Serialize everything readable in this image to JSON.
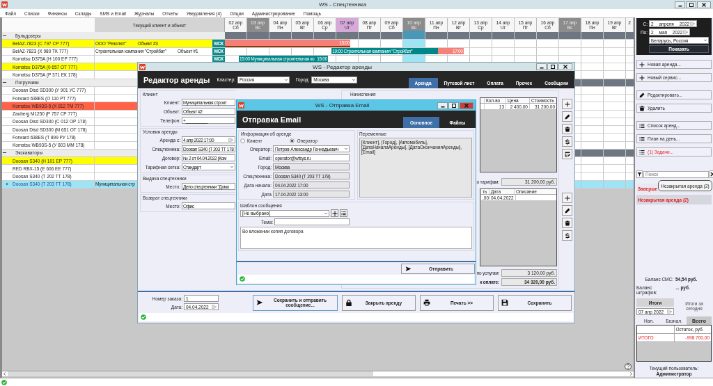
{
  "window": {
    "title": "WS - Спецтехника"
  },
  "menu": [
    "Файл",
    "Списки",
    "Финансы",
    "Склады",
    "SMS и Email",
    "Журналы",
    "Отчеты",
    "Уведомления (4)",
    "Опции",
    "Администрирование",
    "Помощь"
  ],
  "schedule": {
    "client_header": "Текущий клиент и объект",
    "days": [
      {
        "date": "02 апр",
        "weekday": "Сб",
        "kind": "normal",
        "selected": false
      },
      {
        "date": "03 апр",
        "weekday": "Вс",
        "kind": "weekend",
        "selected": false
      },
      {
        "date": "04 апр",
        "weekday": "Пн",
        "kind": "normal",
        "selected": false
      },
      {
        "date": "05 апр",
        "weekday": "Вт",
        "kind": "normal",
        "selected": false
      },
      {
        "date": "06 апр",
        "weekday": "Ср",
        "kind": "normal",
        "selected": false
      },
      {
        "date": "07 апр",
        "weekday": "Чт",
        "kind": "today",
        "selected": false
      },
      {
        "date": "08 апр",
        "weekday": "Пт",
        "kind": "normal",
        "selected": false
      },
      {
        "date": "09 апр",
        "weekday": "Сб",
        "kind": "normal",
        "selected": false
      },
      {
        "date": "10 апр",
        "weekday": "Вс",
        "kind": "weekend",
        "selected": true
      },
      {
        "date": "11 апр",
        "weekday": "Пн",
        "kind": "normal",
        "selected": false
      },
      {
        "date": "12 апр",
        "weekday": "Вт",
        "kind": "normal",
        "selected": false
      },
      {
        "date": "13 апр",
        "weekday": "Ср",
        "kind": "normal",
        "selected": false
      },
      {
        "date": "14 апр",
        "weekday": "Чт",
        "kind": "normal",
        "selected": false
      },
      {
        "date": "15 апр",
        "weekday": "Пт",
        "kind": "normal",
        "selected": false
      },
      {
        "date": "16 апр",
        "weekday": "Сб",
        "kind": "normal",
        "selected": false
      },
      {
        "date": "17 апр",
        "weekday": "Вс",
        "kind": "weekend",
        "selected": false
      },
      {
        "date": "18 апр",
        "weekday": "Пн",
        "kind": "normal",
        "selected": false
      },
      {
        "date": "19 апр",
        "weekday": "Вт",
        "kind": "normal",
        "selected": false
      },
      {
        "date": "2",
        "kind": "normal",
        "selected": false
      }
    ],
    "groups": [
      {
        "name": "Бульдозеры",
        "expanded": true,
        "rows": [
          {
            "vehicle": "BelAZ-7823 (С 797 СР 777)",
            "color": "#ffff00",
            "selected": false,
            "client": "ООО \"Резолют\"",
            "object": "Объект #3",
            "region": "МСК",
            "bars": [
              {
                "kind": "bar",
                "color": "#f58078",
                "end_label": "15:00"
              },
              {
                "kind": "line",
                "color": "#8b3a0c"
              }
            ]
          },
          {
            "vehicle": "BelAZ-7823 (Х 980 ТК 777)",
            "color": "#ffffff",
            "selected": false,
            "client": "Строительная компания \"Стройбат\"",
            "object": "Объект #1",
            "region": "МСК",
            "bars": [
              {
                "kind": "bar",
                "color": "#00878a",
                "label": "19:00 Строительная компания \"Стройбат\""
              },
              {
                "kind": "bar",
                "color": "#f58078",
                "end_label": "17:00"
              }
            ]
          },
          {
            "vehicle": "Komatsu D375A (Н 100 ЕР 777)",
            "color": "#ffffff",
            "selected": false,
            "region": "МСК",
            "bars": [
              {
                "kind": "bar",
                "color": "#00878a",
                "label": "15:00 Муниципальная строительная ко",
                "end_label": "15:00"
              }
            ]
          },
          {
            "vehicle": "Komatsu D375A (0 657 ОТ 777)",
            "color": "#ffff00",
            "selected": false
          },
          {
            "vehicle": "Komatsu D375A (Р 371 ЕК 178)",
            "color": "#ffffff",
            "selected": false
          }
        ]
      },
      {
        "name": "Погрузчики",
        "expanded": true,
        "rows": [
          {
            "vehicle": "Doosan Disd SD300 (У 901 УС 777)",
            "color": "#ffffff",
            "selected": false
          },
          {
            "vehicle": "Forward 638ES (О 110 РТ 777)",
            "color": "#ffffff",
            "selected": false
          },
          {
            "vehicle": "Komatsu WB93S-5 (Х 812 ТМ 777)",
            "color": "#ff6347",
            "selected": false
          },
          {
            "vehicle": "Zauberg M1250 (Р 757 СР 777)",
            "color": "#ffffff",
            "selected": false
          },
          {
            "vehicle": "Doosan Disd SD300 (С 012 ОР 178)",
            "color": "#ffffff",
            "selected": false
          },
          {
            "vehicle": "Doosan Disd SD300 (М 651 ОТ 178)",
            "color": "#ffffff",
            "selected": false
          },
          {
            "vehicle": "Forward 638ES (Т 899 РУ 178)",
            "color": "#ffffff",
            "selected": false
          },
          {
            "vehicle": "Komatsu WB93S-5 (У 803 ММ 178)",
            "color": "#ffffff",
            "selected": false
          }
        ]
      },
      {
        "name": "Экскаваторы",
        "expanded": true,
        "rows": [
          {
            "vehicle": "Doosan S340 (Н 101 ЕР 777)",
            "color": "#ffff00",
            "selected": false
          },
          {
            "vehicle": "RED RBX-15 (Е 606 ЕЕ 777)",
            "color": "#ffffff",
            "selected": false
          },
          {
            "vehicle": "Doosan S340 (Т 202 ТТ 178)",
            "color": "#ffffff",
            "selected": false
          },
          {
            "vehicle": "Doosan S340 (Т 203 ТТ 178)",
            "color": "#9de4f7",
            "selected": true,
            "client": "Муниципальная стр"
          }
        ]
      }
    ]
  },
  "filter_panel": {
    "from_label": "С:",
    "from": "2 апреля 2022",
    "to_label": "По:",
    "to": "2 мая 2022",
    "region": "Беларусь, Россия",
    "show_button": "Показать"
  },
  "action_groups": [
    {
      "buttons": [
        {
          "label": "Новая аренда...",
          "kind": "plus",
          "alert": false
        },
        {
          "label": "Новый сервис...",
          "kind": "plus",
          "alert": false
        }
      ]
    },
    {
      "buttons": [
        {
          "label": "Редактировать...",
          "kind": "pencil",
          "alert": false
        },
        {
          "label": "Удалить",
          "kind": "trash",
          "alert": false
        }
      ]
    },
    {
      "buttons": [
        {
          "label": "Список аренд...",
          "kind": "list",
          "alert": false
        },
        {
          "label": "План на день...",
          "kind": "list",
          "alert": false
        },
        {
          "label": "(1) Задачи...",
          "kind": "list",
          "alert": true
        }
      ]
    }
  ],
  "search": {
    "placeholder": "Поиск"
  },
  "status_filters": [
    {
      "label": "Заверше",
      "selected": false
    },
    {
      "label": "Незакрытая аренда (2)",
      "selected": true
    }
  ],
  "tooltip": "Незакрытая аренда (2)",
  "balances": [
    {
      "label": "Баланс СМС:",
      "value": "54,54 руб."
    },
    {
      "label": "Баланс штрафов:",
      "value": "... руб."
    }
  ],
  "totals": {
    "button": "Итоги",
    "date": "07 апр 2022",
    "caption": "Итоги за сегодня",
    "tabs": [
      {
        "label": "Нал.",
        "selected": false
      },
      {
        "label": "Безнал.",
        "selected": false
      },
      {
        "label": "Всего",
        "selected": true
      }
    ],
    "column": "Остаток, руб.",
    "rows": [
      {
        "label": "ИТОГО",
        "value": "-998 700,00"
      }
    ]
  },
  "current_user": {
    "label": "Текущий пользователь:",
    "name": "Администратор"
  },
  "rental_editor": {
    "title": "WS - Редактор аренды",
    "heading": "Редактор аренды",
    "cluster_label": "Кластер:",
    "cluster": "Россия",
    "city_label": "Город:",
    "city": "Москва",
    "tabs": [
      {
        "label": "Аренда",
        "selected": true
      },
      {
        "label": "Путевой лист",
        "selected": false
      },
      {
        "label": "Оплата",
        "selected": false
      },
      {
        "label": "Прочее",
        "selected": false
      },
      {
        "label": "Сообщени",
        "selected": false
      }
    ],
    "groups": [
      {
        "title": "Клиент",
        "fields": [
          {
            "label": "Клиент:",
            "value": "Муниципальная строит",
            "kind": "text"
          },
          {
            "label": "Объект:",
            "value": "Объект #2",
            "kind": "text"
          },
          {
            "label": "Телефон:",
            "value": "+__________",
            "kind": "text"
          }
        ]
      },
      {
        "title": "Условия аренды",
        "fields": [
          {
            "label": "Аренда с:",
            "value": "4 апр  2022  17:00",
            "kind": "date"
          },
          {
            "label": "Спецтехника:",
            "value": "Doosan S340 (Т 203 ТТ 178",
            "kind": "text"
          },
          {
            "label": "Договор:",
            "value": "№ 2 от 04.04.2022 (Ком",
            "kind": "text"
          },
          {
            "label": "Тарифная сетка:",
            "value": "Стандарт",
            "kind": "select"
          }
        ]
      },
      {
        "title": "Выдача спецтехники",
        "fields": [
          {
            "label": "Место:",
            "value": "Депо спецтехники \"Домо",
            "kind": "text"
          }
        ]
      },
      {
        "title": "Возврат спецтехники",
        "fields": [
          {
            "label": "Место:",
            "value": "Офис",
            "kind": "text"
          }
        ]
      }
    ],
    "charges": {
      "title": "Начисления",
      "columns": [
        "Кол-во",
        "Цена",
        "Стоимость"
      ],
      "rows": [
        [
          "13",
          "2 400,00",
          "31 200,00"
        ]
      ],
      "tariff_label": "о тарифам:",
      "tariff_total": "31 200,00 руб.",
      "service_columns": [
        "ть",
        "Дата",
        "Описание"
      ],
      "service_rows": [
        [
          ",00",
          "04.04.2022"
        ]
      ],
      "services_label": "по услугам:",
      "services_total": "3 120,00 руб.",
      "to_pay_label": "к оплате:",
      "to_pay": "34 320,00 руб."
    },
    "order_label": "Номер заказа:",
    "order": "1",
    "date_label": "Дата:",
    "date": "04.04.2022",
    "buttons": [
      {
        "label": "Сохранить и отправить сообщение...",
        "kind": "send"
      },
      {
        "label": "Закрыть аренду",
        "kind": "lock"
      },
      {
        "label": "Печать  >>",
        "kind": "print"
      },
      {
        "label": "Сохранить",
        "kind": "save"
      }
    ]
  },
  "email_dialog": {
    "title": "WS - Отправка Email",
    "heading": "Отправка Email",
    "tabs": [
      {
        "label": "Основное",
        "selected": true
      },
      {
        "label": "Файлы",
        "selected": false
      }
    ],
    "info_title": "Информация об аренде",
    "recipients": [
      {
        "label": "Клиент",
        "selected": false
      },
      {
        "label": "Оператор",
        "selected": true
      }
    ],
    "fields": [
      {
        "label": "Оператор:",
        "value": "Петров Александр Геннадьевич",
        "kind": "select"
      },
      {
        "label": "Email:",
        "value": "operator@wfsys.ru",
        "kind": "input"
      },
      {
        "label": "Город:",
        "value": "Москва",
        "kind": "readonly"
      },
      {
        "label": "Спецтехника:",
        "value": "Doosan S340 (Т 203 ТТ 178)",
        "kind": "readonly"
      },
      {
        "label": "Дата начала:",
        "value": "04.04.2022 17:00",
        "kind": "readonly"
      },
      {
        "label": "Дата",
        "value": "17.04.2022 13:00",
        "kind": "readonly"
      }
    ],
    "variables_title": "Переменные",
    "variables": "[Клиент], [Город], [Автомобиль], [ДатаНачалаАренды], [ДатаОкончанияАренды], [Email]",
    "template_title": "Шаблон сообщения",
    "template": "[Не выбрано]",
    "subject_label": "Тема:",
    "body": "Во вложении копия договора",
    "send_button": "Отправить"
  }
}
